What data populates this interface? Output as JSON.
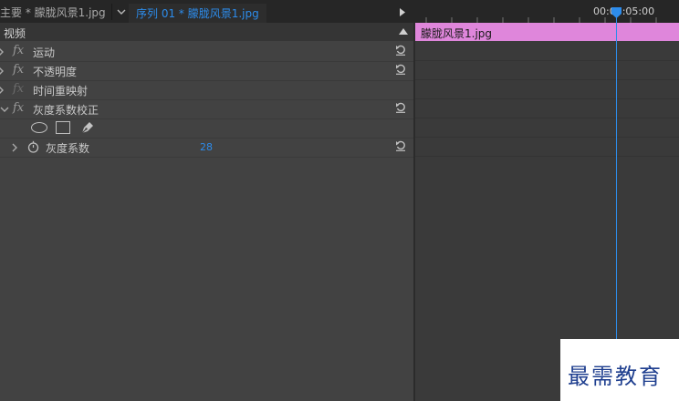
{
  "tabs": {
    "master_label": "主要 * 朦胧风景1.jpg",
    "sequence_label": "序列 01 * 朦胧风景1.jpg"
  },
  "timeline": {
    "timecode": "00:00:05:00",
    "clip_name": "朦胧风景1.jpg"
  },
  "effects": {
    "section_title": "视频",
    "items": [
      {
        "label": "运动",
        "fx_enabled": true
      },
      {
        "label": "不透明度",
        "fx_enabled": true
      },
      {
        "label": "时间重映射",
        "fx_enabled": false
      },
      {
        "label": "灰度系数校正",
        "fx_enabled": true
      }
    ],
    "param": {
      "label": "灰度系数",
      "value": "28"
    }
  },
  "watermark": {
    "text": "最需教育"
  },
  "colors": {
    "accent": "#2d8ceb",
    "clip": "#df86db",
    "panel": "#424242",
    "tabbar": "#262626"
  },
  "icons": [
    "chevron-down-icon",
    "play-triangle-icon",
    "collapse-triangle-icon",
    "chevron-right-icon",
    "chevron-down-icon",
    "reset-icon",
    "ellipse-mask-icon",
    "rectangle-mask-icon",
    "pen-mask-icon",
    "stopwatch-icon",
    "playhead-icon"
  ]
}
